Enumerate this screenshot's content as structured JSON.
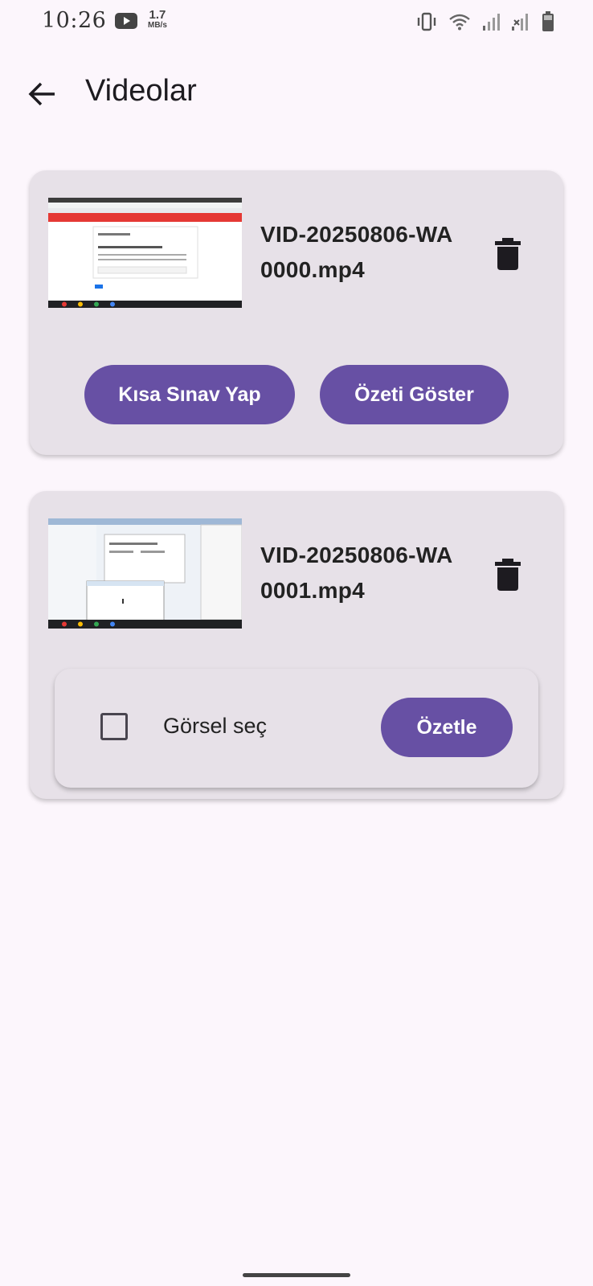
{
  "status_bar": {
    "time": "10:26",
    "speed_value": "1.7",
    "speed_unit": "MB/s",
    "icons": [
      "youtube-icon",
      "vibrate-icon",
      "wifi-icon",
      "signal-icon",
      "signal-no-service-icon",
      "battery-icon"
    ]
  },
  "app_bar": {
    "title": "Videolar",
    "back_icon": "arrow-back-icon"
  },
  "videos": [
    {
      "filename_line1": "VID-20250806-WA",
      "filename_line2": "0000.mp4",
      "quiz_label": "Kısa Sınav Yap",
      "summary_label": "Özeti Göster",
      "delete_icon": "trash-icon"
    },
    {
      "filename_line1": "VID-20250806-WA",
      "filename_line2": "0001.mp4",
      "checkbox_label": "Görsel seç",
      "checkbox_checked": false,
      "summarize_label": "Özetle",
      "delete_icon": "trash-icon"
    }
  ],
  "colors": {
    "background": "#FCF6FC",
    "card": "#E7E1E8",
    "primary": "#6750A4"
  }
}
